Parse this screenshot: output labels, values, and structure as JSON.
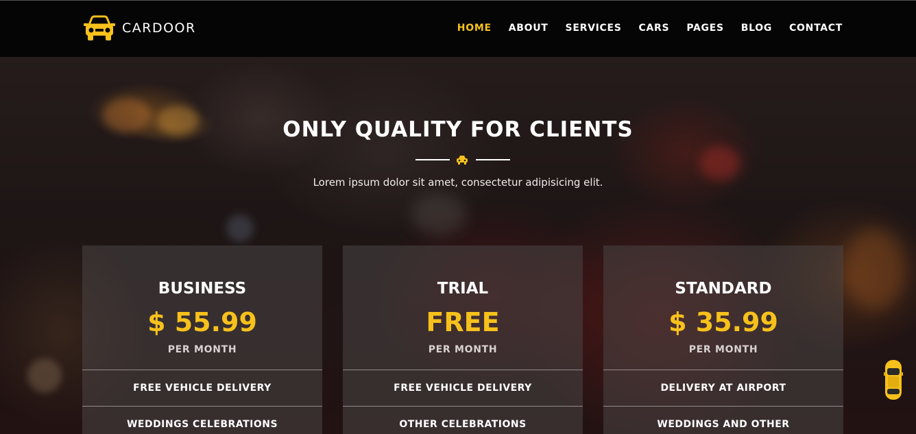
{
  "brand": {
    "name": "CARDOOR",
    "icon": "car-icon"
  },
  "nav": {
    "items": [
      "HOME",
      "ABOUT",
      "SERVICES",
      "CARS",
      "PAGES",
      "BLOG",
      "CONTACT"
    ],
    "active": "HOME"
  },
  "hero": {
    "title": "ONLY QUALITY FOR CLIENTS",
    "subtitle": "Lorem ipsum dolor sit amet, consectetur adipisicing elit."
  },
  "pricing": [
    {
      "plan": "BUSINESS",
      "price": "$ 55.99",
      "period": "PER MONTH",
      "features": [
        "FREE VEHICLE DELIVERY",
        "WEDDINGS CELEBRATIONS"
      ]
    },
    {
      "plan": "TRIAL",
      "price": "FREE",
      "period": "PER MONTH",
      "features": [
        "FREE VEHICLE DELIVERY",
        "OTHER CELEBRATIONS"
      ]
    },
    {
      "plan": "STANDARD",
      "price": "$ 35.99",
      "period": "PER MONTH",
      "features": [
        "DELIVERY AT AIRPORT",
        "WEDDINGS AND OTHER"
      ]
    }
  ],
  "colors": {
    "accent": "#f7c11c",
    "header_bg": "#050505",
    "text": "#ffffff"
  }
}
